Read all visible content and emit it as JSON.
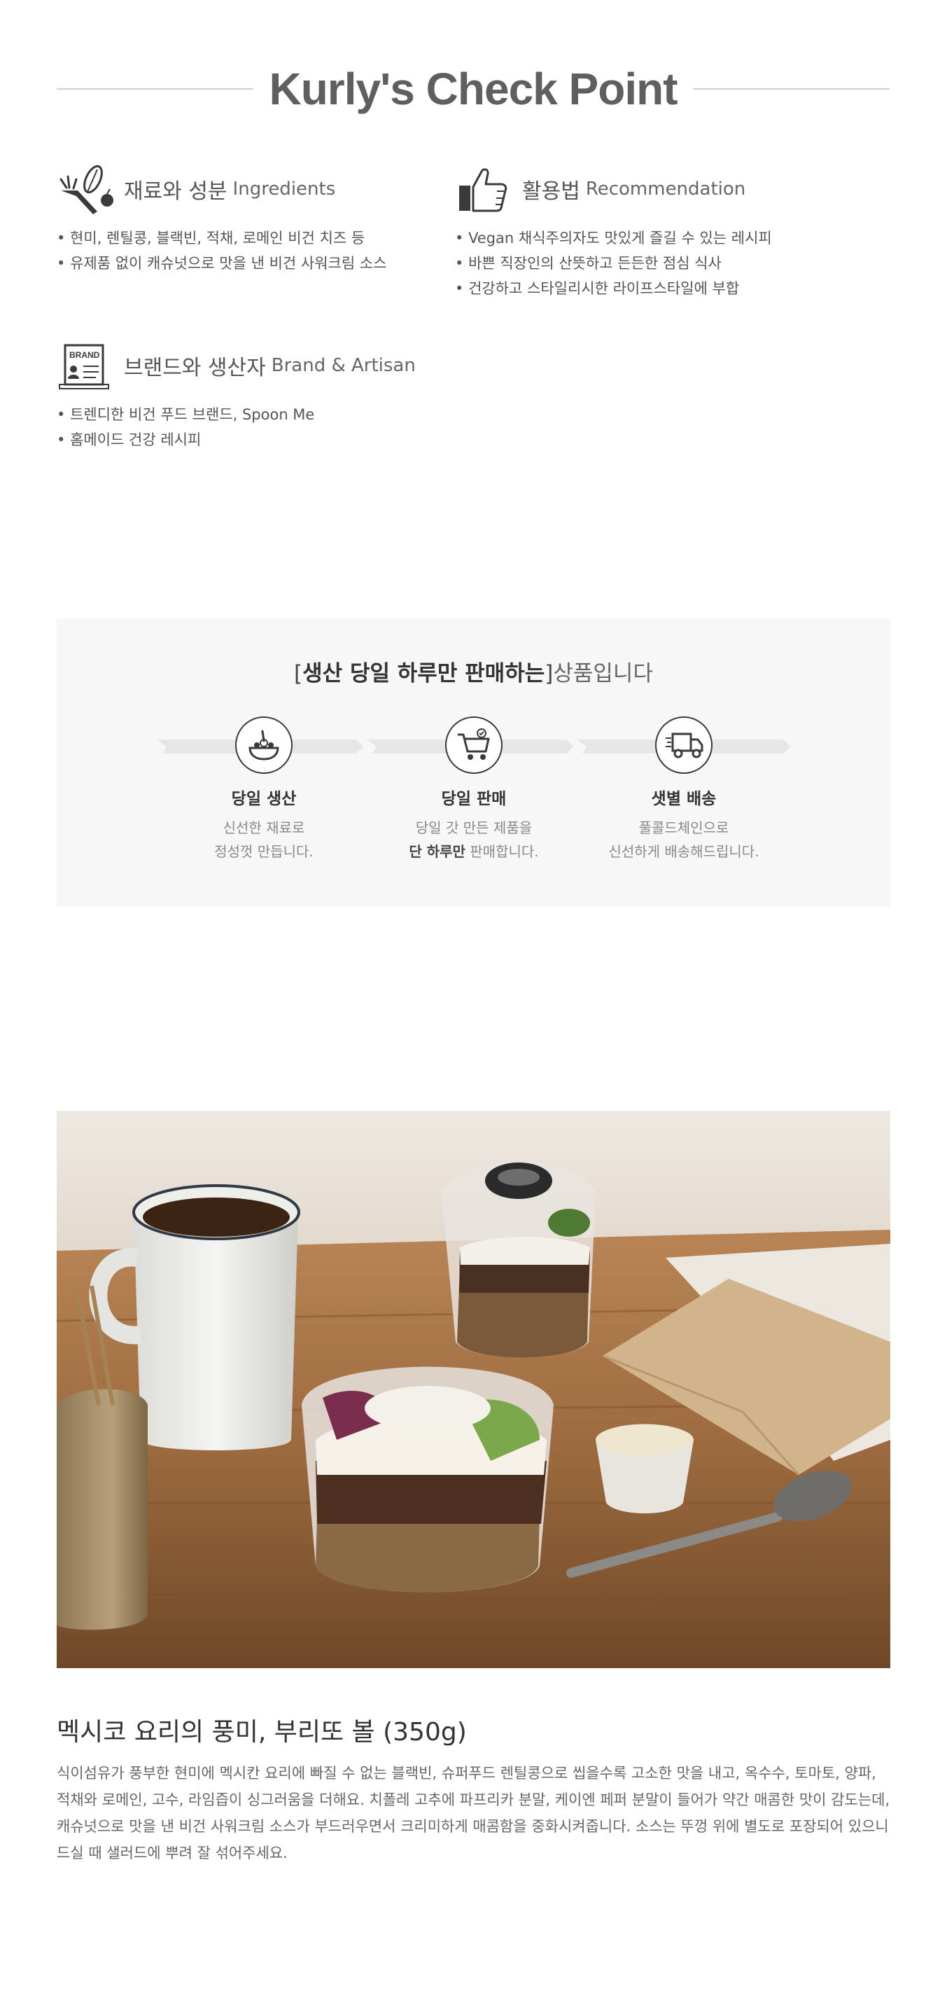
{
  "checkpoint": {
    "title": "Kurly's Check Point",
    "ingredients": {
      "label_ko": "재료와 성분",
      "label_en": "Ingredients",
      "items": [
        "현미, 렌틸콩, 블랙빈, 적채, 로메인 비건 치즈 등",
        "유제품 없이 캐슈넛으로 맛을 낸 비건 사워크림 소스"
      ]
    },
    "recommendation": {
      "label_ko": "활용법",
      "label_en": "Recommendation",
      "items": [
        "Vegan 채식주의자도 맛있게 즐길 수 있는 레시피",
        "바쁜 직장인의 산뜻하고 든든한 점심 식사",
        "건강하고 스타일리시한 라이프스타일에 부합"
      ]
    },
    "brand": {
      "label_ko": "브랜드와 생산자",
      "label_en": "Brand & Artisan",
      "icon_text": "BRAND",
      "items": [
        "트렌디한 비건 푸드 브랜드, Spoon Me",
        "홈메이드 건강 레시피"
      ]
    }
  },
  "fresh": {
    "bracket_open": "[",
    "title_strong": "생산 당일 하루만 판매하는",
    "bracket_close": "]",
    "title_light": "상품입니다",
    "steps": [
      {
        "icon": "salad-bowl-icon",
        "title": "당일 생산",
        "line1": "신선한 재료로",
        "line2": "정성껏 만듭니다."
      },
      {
        "icon": "shopping-cart-icon",
        "title": "당일 판매",
        "line1": "당일 갓 만든 제품을",
        "line2_strong": "단 하루만",
        "line2_rest": " 판매합니다."
      },
      {
        "icon": "delivery-truck-icon",
        "title": "샛별 배송",
        "line1": "풀콜드체인으로",
        "line2": "신선하게 배송해드립니다."
      }
    ]
  },
  "product": {
    "title": "멕시코 요리의 풍미, 부리또 볼 (350g)",
    "description": "식이섬유가 풍부한 현미에 멕시칸 요리에 빠질 수 없는 블랙빈, 슈퍼푸드 렌틸콩으로 씹을수록 고소한 맛을 내고, 옥수수, 토마토, 양파, 적채와 로메인, 고수, 라임즙이 싱그러움을 더해요. 치폴레 고추에 파프리카 분말, 케이엔 페퍼 분말이 들어가 약간 매콤한 맛이 감도는데, 캐슈넛으로 맛을 낸 비건 사워크림 소스가 부드러우면서 크리미하게 매콤함을 중화시켜줍니다. 소스는 뚜껑 위에 별도로 포장되어 있으니 드실 때 샐러드에 뿌려 잘 섞어주세요."
  }
}
